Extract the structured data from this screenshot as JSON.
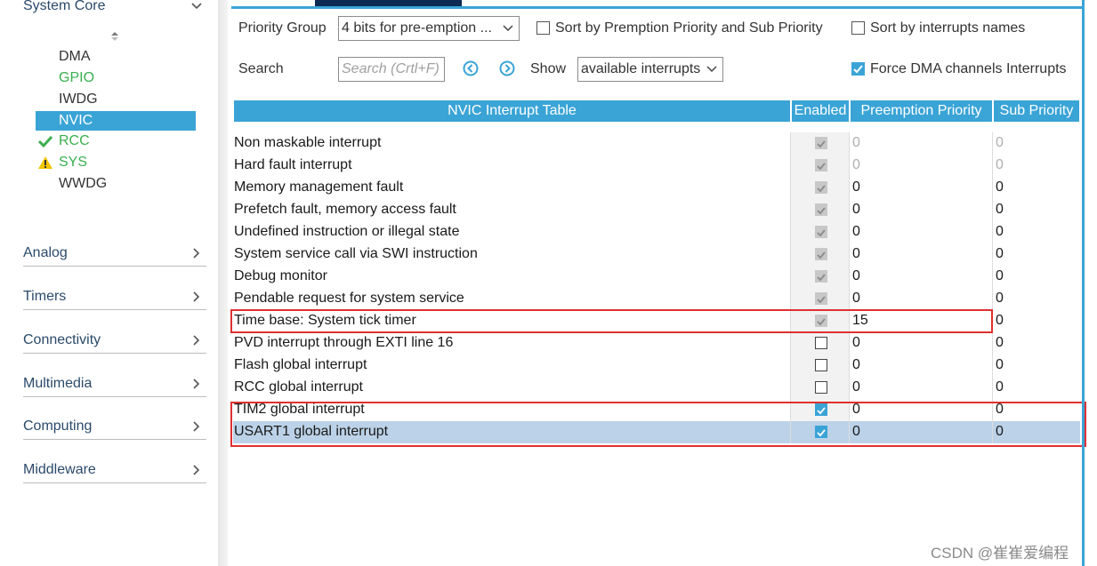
{
  "sidebar": {
    "top_category": "System Core",
    "items": [
      {
        "label": "DMA",
        "status": "none"
      },
      {
        "label": "GPIO",
        "status": "none"
      },
      {
        "label": "IWDG",
        "status": "none"
      },
      {
        "label": "NVIC",
        "status": "selected"
      },
      {
        "label": "RCC",
        "status": "ok"
      },
      {
        "label": "SYS",
        "status": "warning"
      },
      {
        "label": "WWDG",
        "status": "none"
      }
    ],
    "categories": [
      "Analog",
      "Timers",
      "Connectivity",
      "Multimedia",
      "Computing",
      "Middleware"
    ]
  },
  "toolbar": {
    "priority_group_label": "Priority Group",
    "priority_group_value": "4 bits for pre-emption ...",
    "sort_premption_label": "Sort by Premption Priority and Sub Priority",
    "sort_premption_checked": false,
    "sort_names_label": "Sort by interrupts names",
    "sort_names_checked": false,
    "search_label": "Search",
    "search_placeholder": "Search (Crtl+F)",
    "show_label": "Show",
    "show_value": "available interrupts",
    "force_dma_label": "Force DMA channels Interrupts",
    "force_dma_checked": true
  },
  "table": {
    "headers": {
      "name": "NVIC Interrupt Table",
      "enabled": "Enabled",
      "preemption": "Preemption Priority",
      "sub": "Sub Priority"
    },
    "rows": [
      {
        "name": "Non maskable interrupt",
        "enabled": "locked",
        "preemption": "0",
        "sub": "0",
        "dim": true
      },
      {
        "name": "Hard fault interrupt",
        "enabled": "locked",
        "preemption": "0",
        "sub": "0",
        "dim": true
      },
      {
        "name": "Memory management fault",
        "enabled": "locked",
        "preemption": "0",
        "sub": "0"
      },
      {
        "name": "Prefetch fault, memory access fault",
        "enabled": "locked",
        "preemption": "0",
        "sub": "0"
      },
      {
        "name": "Undefined instruction or illegal state",
        "enabled": "locked",
        "preemption": "0",
        "sub": "0"
      },
      {
        "name": "System service call via SWI instruction",
        "enabled": "locked",
        "preemption": "0",
        "sub": "0"
      },
      {
        "name": "Debug monitor",
        "enabled": "locked",
        "preemption": "0",
        "sub": "0"
      },
      {
        "name": "Pendable request for system service",
        "enabled": "locked",
        "preemption": "0",
        "sub": "0"
      },
      {
        "name": "Time base: System tick timer",
        "enabled": "locked",
        "preemption": "15",
        "sub": "0"
      },
      {
        "name": "PVD interrupt through EXTI line 16",
        "enabled": "off",
        "preemption": "0",
        "sub": "0"
      },
      {
        "name": "Flash global interrupt",
        "enabled": "off",
        "preemption": "0",
        "sub": "0"
      },
      {
        "name": "RCC global interrupt",
        "enabled": "off",
        "preemption": "0",
        "sub": "0"
      },
      {
        "name": "TIM2 global interrupt",
        "enabled": "on",
        "preemption": "0",
        "sub": "0"
      },
      {
        "name": "USART1 global interrupt",
        "enabled": "on",
        "preemption": "0",
        "sub": "0",
        "selected": true
      }
    ]
  },
  "watermark": "CSDN @崔崔爱编程",
  "colors": {
    "accent": "#3aa4d6",
    "highlight_box": "#e03030",
    "ok_green": "#3aaf4e",
    "warning_yellow": "#f2c500",
    "selected_row": "#bcd2e8"
  }
}
